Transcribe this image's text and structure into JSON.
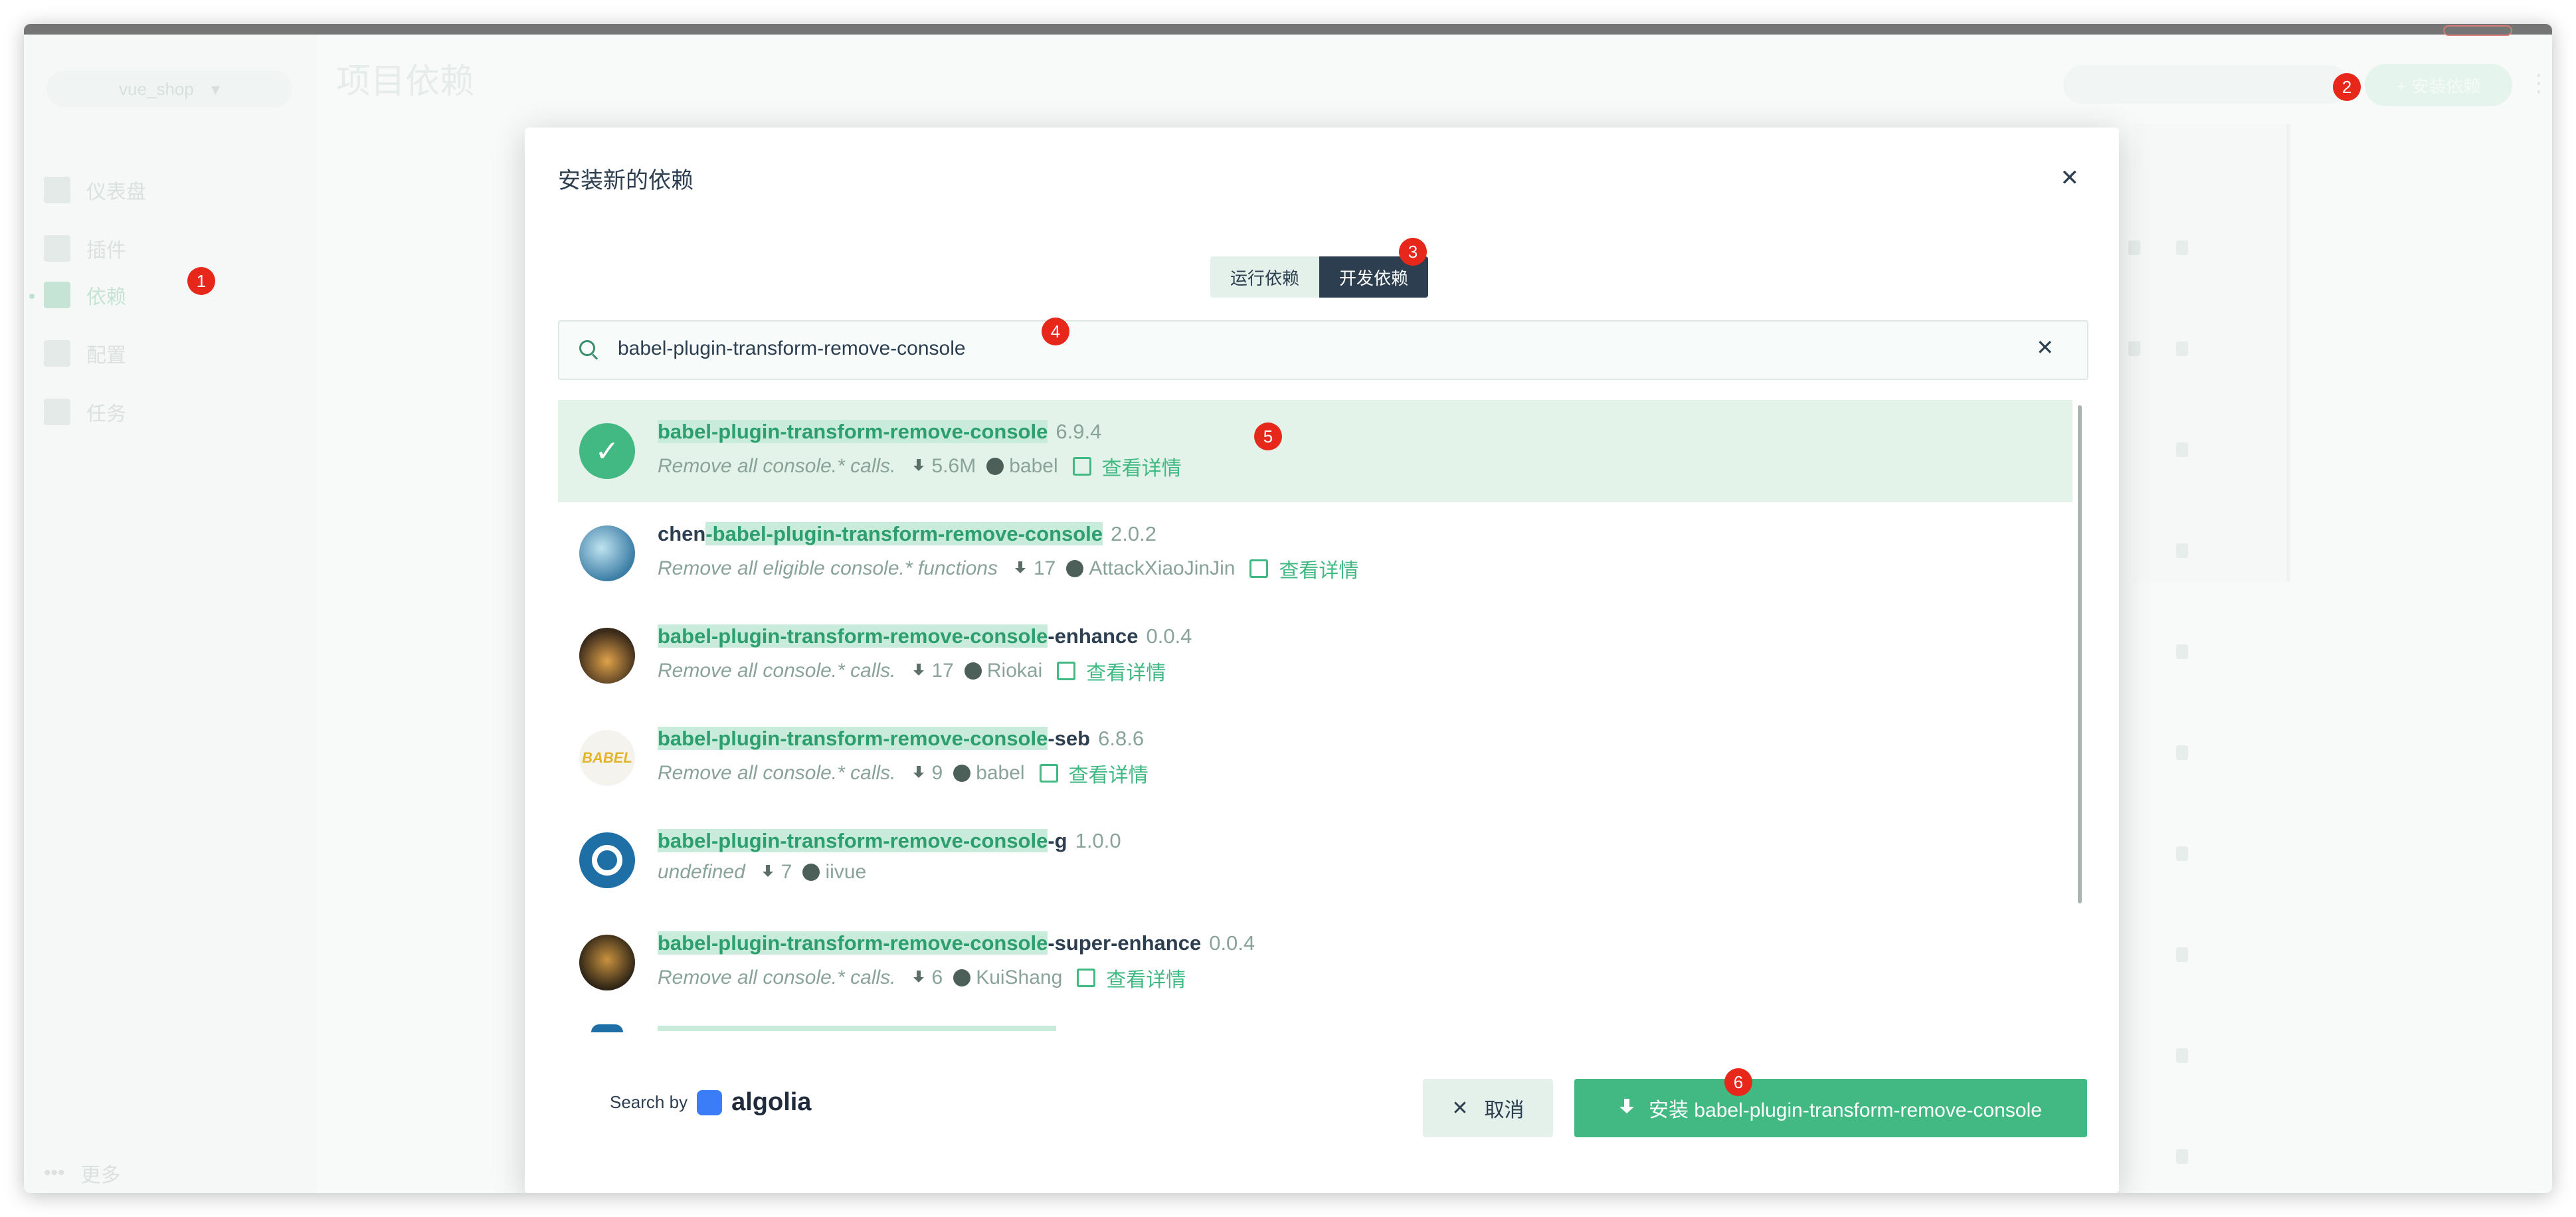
{
  "sidebar": {
    "project": "vue_shop",
    "items": [
      {
        "label": "仪表盘",
        "icon": "dashboard-icon"
      },
      {
        "label": "插件",
        "icon": "puzzle-icon"
      },
      {
        "label": "依赖",
        "icon": "dependency-icon"
      },
      {
        "label": "配置",
        "icon": "gear-icon"
      },
      {
        "label": "任务",
        "icon": "clipboard-icon"
      }
    ],
    "more": "更多"
  },
  "header": {
    "title": "项目依赖",
    "install_label": "+ 安装依赖"
  },
  "modal": {
    "title": "安装新的依赖",
    "tabs": [
      "运行依赖",
      "开发依赖"
    ],
    "active_tab": "开发依赖",
    "search_value": "babel-plugin-transform-remove-console",
    "search_by": "Search by",
    "search_provider": "algolia",
    "cancel_label": "取消",
    "install_label": "安装 babel-plugin-transform-remove-console"
  },
  "results": [
    {
      "prefix": "",
      "match": "babel-plugin-transform-remove-console",
      "suffix": "",
      "version": "6.9.4",
      "description": "Remove all console.* calls.",
      "downloads": "5.6M",
      "author": "babel",
      "details": "查看详情",
      "selected": true
    },
    {
      "prefix": "chen",
      "match": "-babel-plugin-transform-remove-console",
      "suffix": "",
      "version": "2.0.2",
      "description": "Remove all eligible console.* functions",
      "downloads": "17",
      "author": "AttackXiaoJinJin",
      "details": "查看详情",
      "selected": false
    },
    {
      "prefix": "",
      "match": "babel-plugin-transform-remove-console",
      "suffix": "-enhance",
      "version": "0.0.4",
      "description": "Remove all console.* calls.",
      "downloads": "17",
      "author": "Riokai",
      "details": "查看详情",
      "selected": false
    },
    {
      "prefix": "",
      "match": "babel-plugin-transform-remove-console",
      "suffix": "-seb",
      "version": "6.8.6",
      "description": "Remove all console.* calls.",
      "downloads": "9",
      "author": "babel",
      "details": "查看详情",
      "selected": false
    },
    {
      "prefix": "",
      "match": "babel-plugin-transform-remove-console",
      "suffix": "-g",
      "version": "1.0.0",
      "description": "undefined",
      "downloads": "7",
      "author": "iivue",
      "details": "",
      "selected": false
    },
    {
      "prefix": "",
      "match": "babel-plugin-transform-remove-console",
      "suffix": "-super-enhance",
      "version": "0.0.4",
      "description": "Remove all console.* calls.",
      "downloads": "6",
      "author": "KuiShang",
      "details": "查看详情",
      "selected": false
    }
  ],
  "badges": [
    "1",
    "2",
    "3",
    "4",
    "5",
    "6"
  ],
  "colors": {
    "accent": "#42b983",
    "dark": "#2c3e50",
    "badge": "#e8271b"
  }
}
